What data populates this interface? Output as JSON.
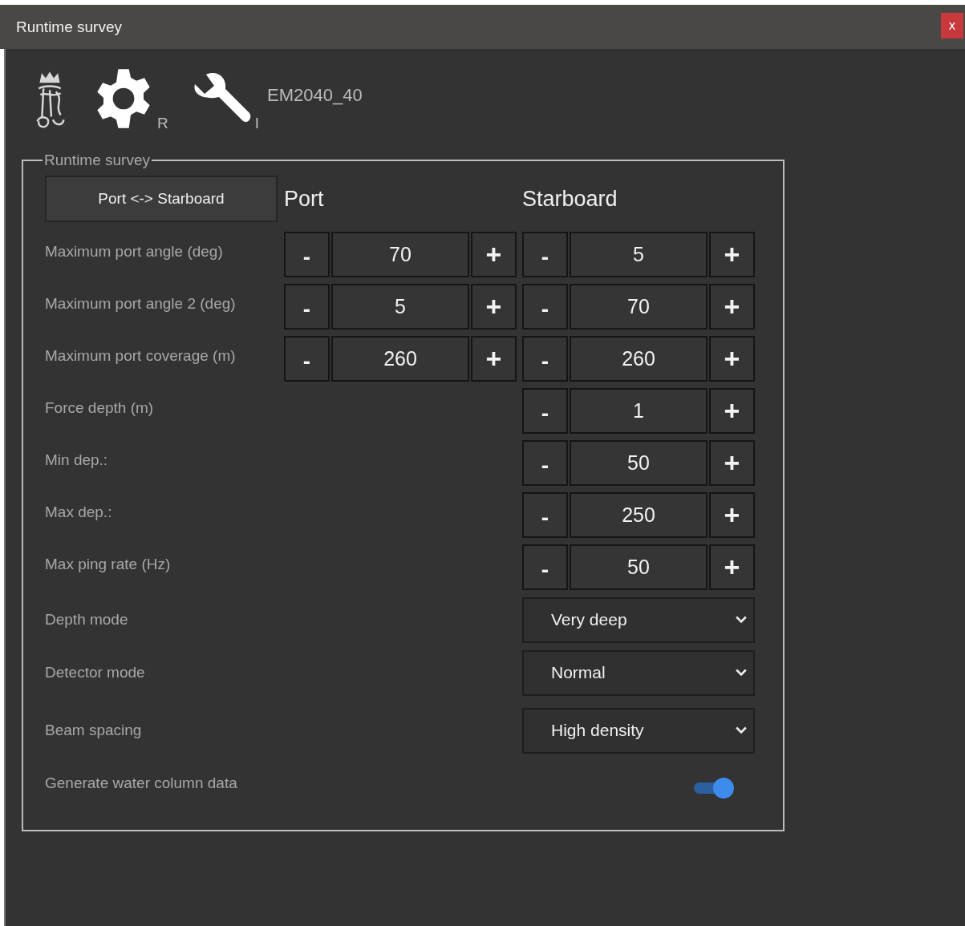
{
  "window": {
    "title": "Runtime survey",
    "close": "x"
  },
  "header": {
    "settings_mark": "R",
    "tool_mark": "I",
    "device": "EM2040_40"
  },
  "group": {
    "title": "Runtime survey",
    "swap_button": "Port <-> Starboard",
    "port_heading": "Port",
    "starboard_heading": "Starboard",
    "rows": [
      {
        "kind": "dual",
        "label": "Maximum port angle (deg)",
        "port": {
          "minus": "-",
          "value": "70",
          "plus": "+"
        },
        "starboard": {
          "minus": "-",
          "value": "5",
          "plus": "+"
        }
      },
      {
        "kind": "dual",
        "label": "Maximum port angle 2 (deg)",
        "port": {
          "minus": "-",
          "value": "5",
          "plus": "+"
        },
        "starboard": {
          "minus": "-",
          "value": "70",
          "plus": "+"
        }
      },
      {
        "kind": "dual",
        "label": "Maximum port coverage (m)",
        "port": {
          "minus": "-",
          "value": "260",
          "plus": "+"
        },
        "starboard": {
          "minus": "-",
          "value": "260",
          "plus": "+"
        }
      },
      {
        "kind": "single",
        "label": "Force depth (m)",
        "starboard": {
          "minus": "-",
          "value": "1",
          "plus": "+"
        }
      },
      {
        "kind": "single",
        "label": "Min dep.:",
        "starboard": {
          "minus": "-",
          "value": "50",
          "plus": "+"
        }
      },
      {
        "kind": "single",
        "label": "Max dep.:",
        "starboard": {
          "minus": "-",
          "value": "250",
          "plus": "+"
        }
      },
      {
        "kind": "single",
        "label": "Max ping rate (Hz)",
        "starboard": {
          "minus": "-",
          "value": "50",
          "plus": "+"
        }
      },
      {
        "kind": "select",
        "label": "Depth mode",
        "value": "Very deep"
      },
      {
        "kind": "select",
        "label": "Detector mode",
        "value": "Normal"
      },
      {
        "kind": "select",
        "label": "Beam spacing",
        "value": "High density"
      },
      {
        "kind": "toggle",
        "label": "Generate water column data",
        "on": true
      }
    ]
  }
}
